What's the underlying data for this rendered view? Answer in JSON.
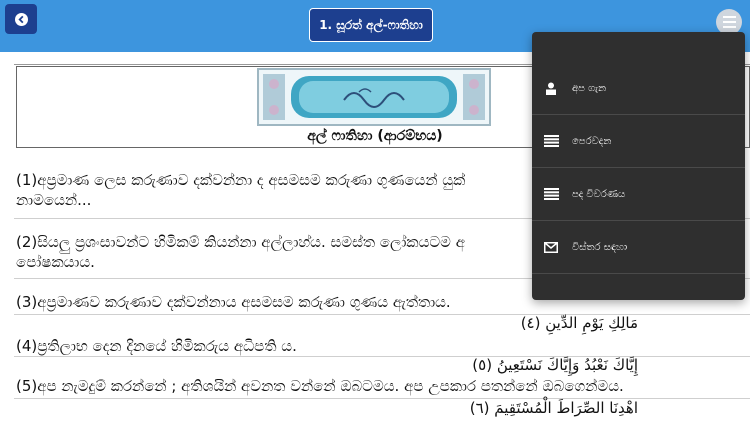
{
  "header": {
    "title": "1. සූරත් අල්-ෆාතිහා"
  },
  "banner": {
    "caption": "අල් ෆාතිහා (ආරම්භය)"
  },
  "verses": [
    {
      "line1": "(1)අප්‍රමාණ ලෙස කරුණාව දක්වන්නා ද අසමසම කරුණා ගුණයෙන් යුක්",
      "line2": "නාමයෙන්..."
    },
    {
      "line1": "(2)සියලු ප්‍රශංසාවන්ට හිමිකම් කියන්නා අල්ලාහ්ය. සමස්ත ලෝකයටම අ",
      "line2": "පෝෂකයාය."
    },
    {
      "line1": "(3)අප්‍රමාණව කරුණාව දක්වන්නාය අසමසම කරුණා ගුණය ඇත්තාය."
    },
    {
      "line1": "(4)ප්‍රතිලාභ දෙන දිනයේ හිමිකරුය අධිපති ය."
    },
    {
      "line1": "(5)අප නැමදුම් කරන්නේ ; අතිශයින් අවනත වන්නේ ඔබටමය. අප උපකාර පතන්නේ ඔබගෙන්මය."
    }
  ],
  "arabic": {
    "v4": "مَالِكِ يَوْمِ الدِّينِ (٤)",
    "v5": "إِيَّاكَ نَعْبُدُ وَإِيَّاكَ نَسْتَعِينُ (٥)",
    "v6": "اهْدِنَا الصِّرَاطَ الْمُسْتَقِيمَ (٦)"
  },
  "menu": {
    "items": [
      {
        "label": "අප ගැන",
        "icon": "user-icon"
      },
      {
        "label": "පෙරවදන",
        "icon": "list-icon"
      },
      {
        "label": "පද විවරණය",
        "icon": "list-icon"
      },
      {
        "label": "විස්තර සඳහා",
        "icon": "envelope-icon"
      }
    ]
  },
  "colors": {
    "topbar": "#3d95de",
    "button": "#1d3f8f",
    "menu_bg": "#2f2f2f"
  }
}
